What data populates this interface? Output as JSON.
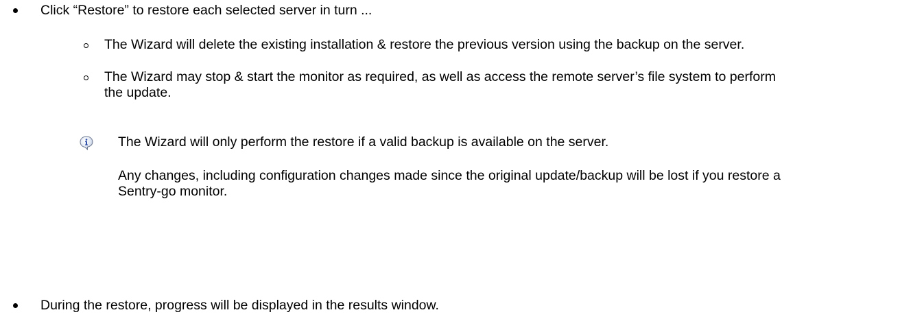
{
  "document": {
    "bullets": [
      {
        "text": "Click “Restore” to restore each selected server in turn ...",
        "sub_items": [
          "The Wizard will delete the existing installation & restore the previous version using the backup on the server.",
          "The Wizard may stop & start the monitor as required, as well as access the remote server’s file system to perform the update."
        ]
      },
      {
        "text": "During the restore, progress will be displayed in the results window."
      }
    ],
    "note": {
      "icon": "info-icon",
      "line1": "The Wizard will only perform the restore if a valid backup is available on the server.",
      "line2": "Any changes, including configuration changes made since the original update/backup will be lost if you restore a Sentry-go monitor."
    }
  }
}
